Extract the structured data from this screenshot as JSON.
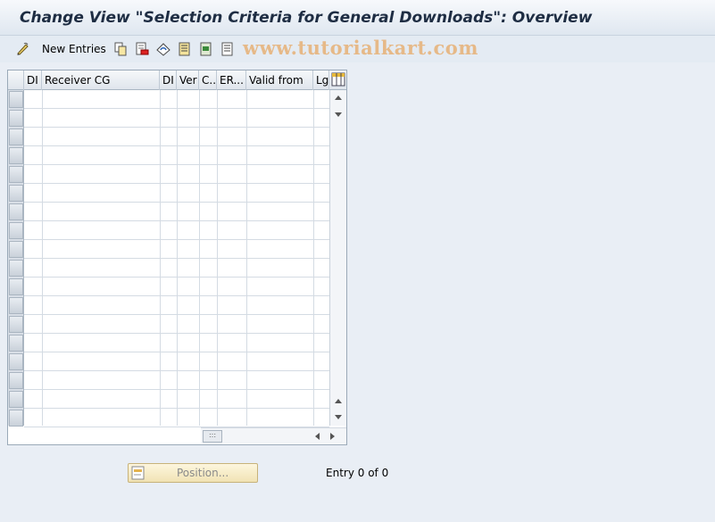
{
  "window": {
    "title": "Change View \"Selection Criteria for General Downloads\": Overview"
  },
  "toolbar": {
    "new_entries_label": "New Entries",
    "icons": [
      "edit-toggle-icon",
      "copy-icon",
      "delete-icon",
      "undo-icon",
      "select-all-icon",
      "select-block-icon",
      "deselect-all-icon"
    ]
  },
  "watermark": "www.tutorialkart.com",
  "table": {
    "columns": [
      "DI",
      "Receiver CG",
      "DI",
      "Ver",
      "C..",
      "ER...",
      "Valid from",
      "Lg"
    ],
    "row_count": 18,
    "rows": []
  },
  "footer": {
    "position_label": "Position...",
    "entry_text": "Entry 0 of 0"
  },
  "colors": {
    "title_bar": "#dfe7f0",
    "background": "#e9eef5",
    "position_button": "#f1e3b4",
    "watermark": "#e6b988"
  }
}
